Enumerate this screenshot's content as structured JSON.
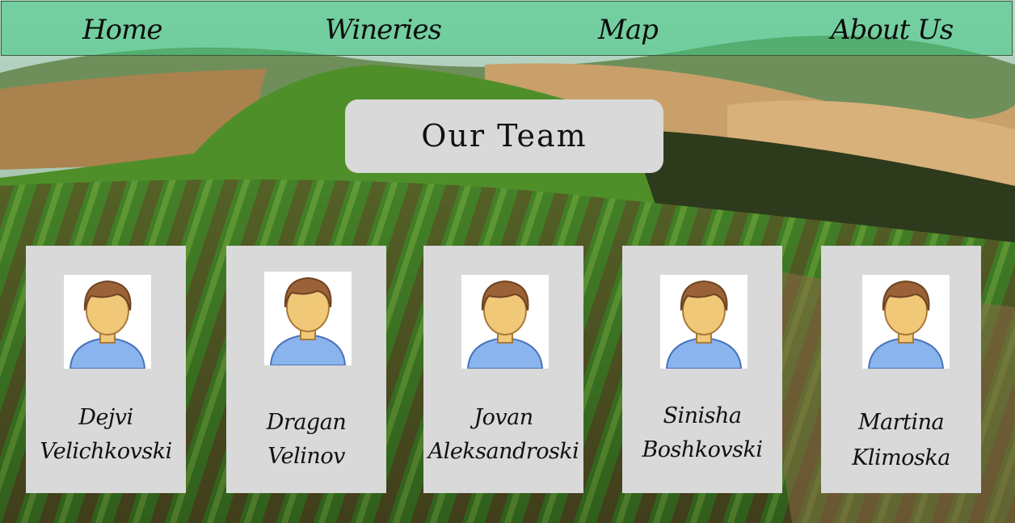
{
  "nav": {
    "home": "Home",
    "wineries": "Wineries",
    "map": "Map",
    "about": "About Us"
  },
  "page_title": "Our Team",
  "team": [
    {
      "first": "Dejvi",
      "last": "Velichkovski",
      "icon": "user-avatar-icon"
    },
    {
      "first": "Dragan",
      "last": "Velinov",
      "icon": "user-avatar-icon"
    },
    {
      "first": "Jovan",
      "last": "Aleksandroski",
      "icon": "user-avatar-icon"
    },
    {
      "first": "Sinisha",
      "last": "Boshkovski",
      "icon": "user-avatar-icon"
    },
    {
      "first": "Martina",
      "last": "Klimoska",
      "icon": "user-avatar-icon"
    }
  ],
  "colors": {
    "nav_tint": "#3cc882",
    "card_bg": "#d9d9d9",
    "avatar_hair": "#9a6236",
    "avatar_skin": "#f0c878",
    "avatar_shirt": "#8ab4ee"
  },
  "background": "vineyard-hills-image"
}
